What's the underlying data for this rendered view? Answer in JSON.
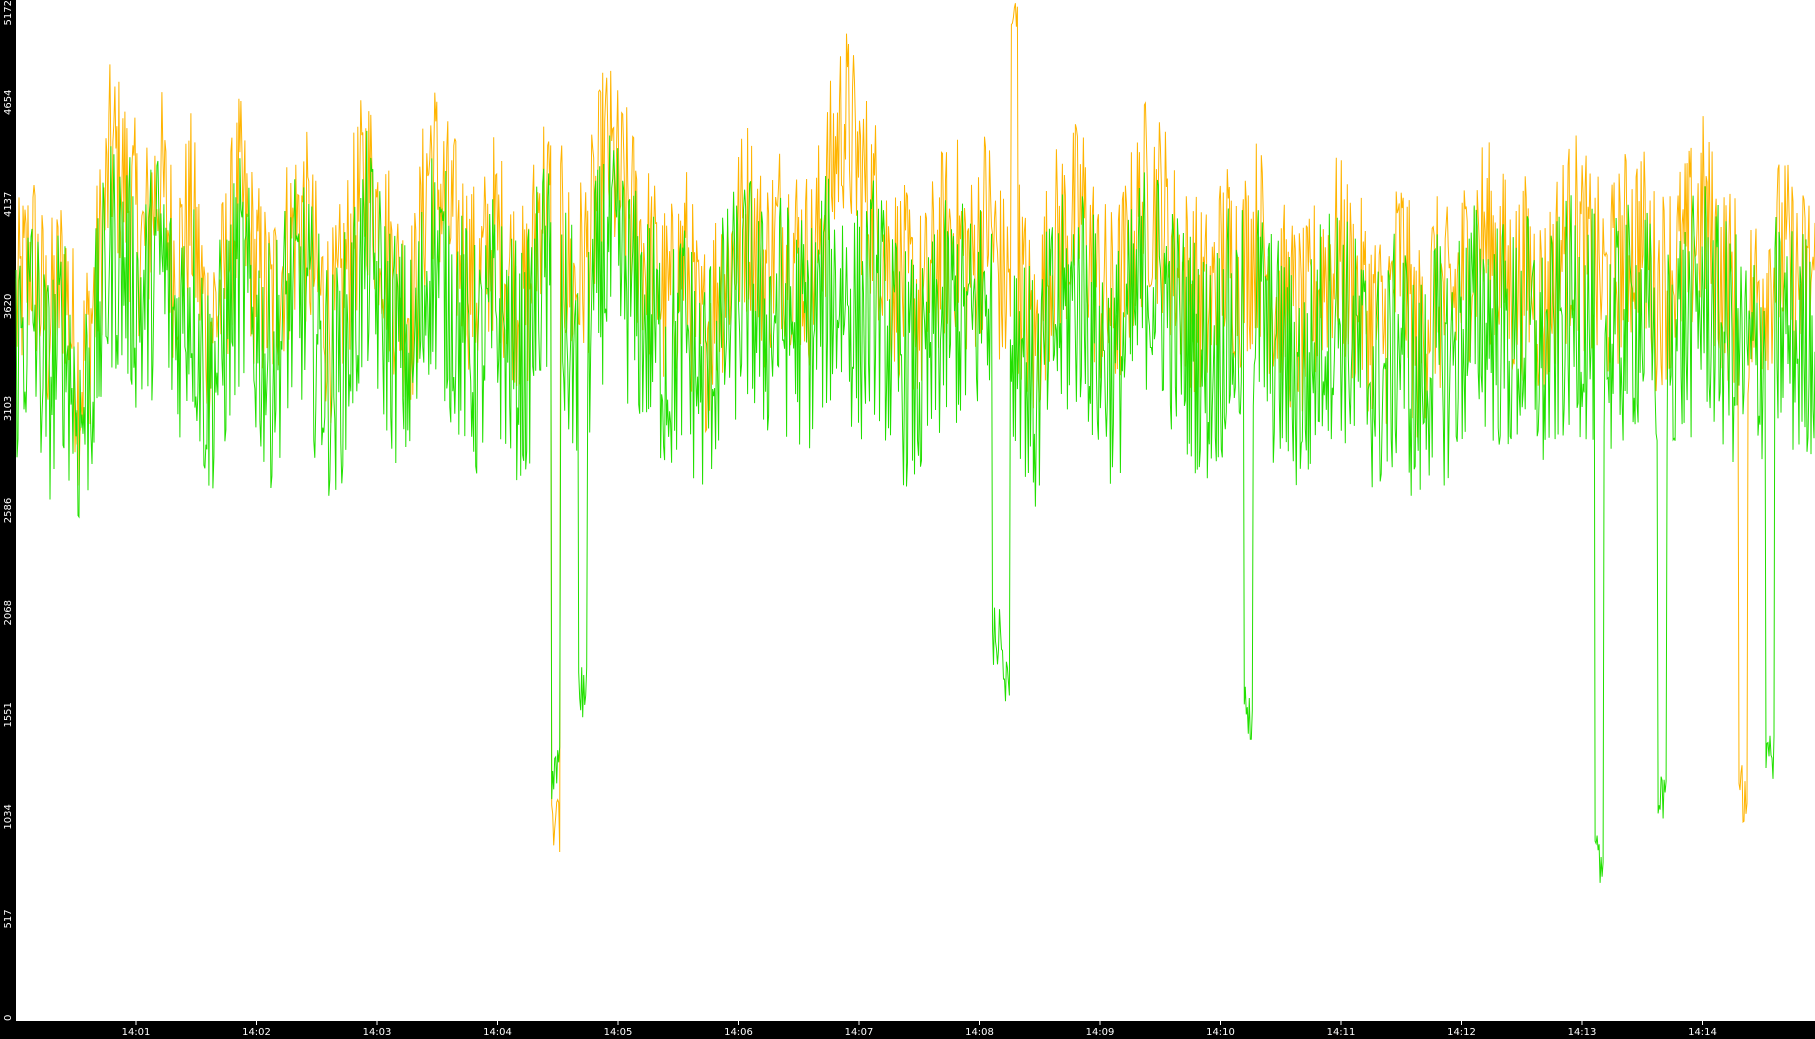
{
  "chart_data": {
    "type": "line",
    "title": "",
    "xlabel": "",
    "ylabel": "",
    "x_range": [
      "14:00",
      "14:15"
    ],
    "ylim": [
      0,
      5172
    ],
    "y_ticks": [
      0,
      517,
      1034,
      1551,
      2068,
      2586,
      3103,
      3620,
      4137,
      4654,
      5172
    ],
    "x_ticks": [
      "14:01",
      "14:02",
      "14:03",
      "14:04",
      "14:05",
      "14:06",
      "14:07",
      "14:08",
      "14:09",
      "14:10",
      "14:11",
      "14:12",
      "14:13",
      "14:14"
    ],
    "grid": false,
    "legend": "none",
    "series": [
      {
        "color": "#ffb400",
        "values": [
          3600,
          3900,
          3500,
          3800,
          3200,
          3700,
          4400,
          4200,
          3900,
          4300,
          3800,
          4100,
          3500,
          3700,
          4200,
          3800,
          3600,
          3900,
          4100,
          3700,
          3500,
          3900,
          4300,
          4000,
          3700,
          3600,
          4400,
          4100,
          3900,
          3700,
          4000,
          3800,
          3600,
          4200,
          4000,
          3700,
          3900,
          4400,
          4200,
          4000,
          3800,
          3600,
          3900,
          3400,
          3700,
          3900,
          4100,
          3800,
          4000,
          3900,
          3800,
          4200,
          4600,
          4300,
          4100,
          3800,
          3700,
          3600,
          3900,
          4000,
          3800,
          4100,
          3700,
          3800,
          3400,
          3900,
          4000,
          4100,
          3700,
          3600,
          3900,
          4200,
          4100,
          3800,
          3700,
          3600,
          3900,
          3800,
          4000,
          3700,
          3600,
          3500,
          3800,
          3900,
          3700,
          3600,
          3500,
          3900,
          3400,
          3700,
          3600,
          3800,
          4000,
          3900,
          3700,
          3800,
          3600,
          3900,
          4000,
          3800,
          3700,
          3900,
          4000,
          3700,
          3800,
          3900,
          4100,
          3800,
          3700,
          3600,
          3800,
          3900,
          3700,
          3800
        ]
      },
      {
        "color": "#22e000",
        "values": [
          3400,
          3600,
          3200,
          3500,
          3000,
          3400,
          3900,
          3800,
          3600,
          3900,
          3500,
          3700,
          3200,
          3400,
          3800,
          3500,
          3300,
          3600,
          3700,
          3400,
          3200,
          3500,
          3900,
          3600,
          3400,
          3300,
          3900,
          3700,
          3500,
          3300,
          3600,
          3400,
          3300,
          3800,
          3600,
          3400,
          3500,
          3900,
          3800,
          3600,
          3500,
          3300,
          3500,
          3200,
          3400,
          3600,
          3700,
          3500,
          3600,
          3500,
          3500,
          3700,
          3700,
          3500,
          3700,
          3400,
          3300,
          3200,
          3500,
          3600,
          3500,
          3700,
          3400,
          3500,
          3100,
          3500,
          3600,
          3700,
          3400,
          3300,
          3500,
          3800,
          3700,
          3500,
          3400,
          3300,
          3500,
          3500,
          3600,
          3400,
          3300,
          3200,
          3500,
          3600,
          3400,
          3300,
          3200,
          3500,
          3100,
          3400,
          3300,
          3500,
          3600,
          3500,
          3400,
          3500,
          3300,
          3500,
          3600,
          3500,
          3400,
          3500,
          3600,
          3400,
          3500,
          3500,
          3700,
          3500,
          3400,
          3300,
          3500,
          3500,
          3400,
          3500
        ]
      }
    ],
    "dips": [
      {
        "x": 0.3,
        "series": 0,
        "value": 850
      },
      {
        "x": 0.3,
        "series": 1,
        "value": 1100
      },
      {
        "x": 0.315,
        "series": 1,
        "value": 1500
      },
      {
        "x": 0.55,
        "series": 1,
        "value": 1600
      },
      {
        "x": 0.545,
        "series": 1,
        "value": 1800
      },
      {
        "x": 0.685,
        "series": 1,
        "value": 1400
      },
      {
        "x": 0.88,
        "series": 1,
        "value": 650
      },
      {
        "x": 0.915,
        "series": 1,
        "value": 950
      },
      {
        "x": 0.96,
        "series": 0,
        "value": 1000
      },
      {
        "x": 0.975,
        "series": 1,
        "value": 1150
      }
    ],
    "peaks": [
      {
        "x": 0.555,
        "series": 0,
        "value": 5172
      }
    ]
  }
}
